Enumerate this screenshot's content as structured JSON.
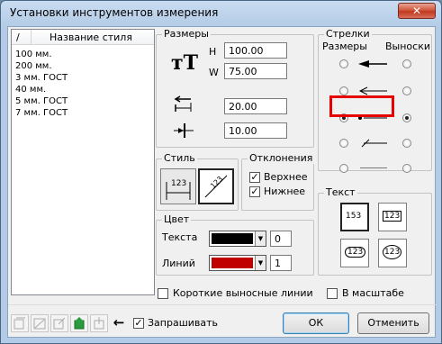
{
  "window": {
    "title": "Установки инструментов измерения",
    "close_glyph": "✕"
  },
  "list": {
    "sort_glyph": "/",
    "header": "Название стиля",
    "items": [
      "100 мм.",
      "200 мм.",
      "3 мм. ГОСТ",
      "40 мм.",
      "5 мм. ГОСТ",
      "7 мм. ГОСТ"
    ]
  },
  "sizes": {
    "label": "Размеры",
    "font_icon": "тТ",
    "h_label": "H",
    "w_label": "W",
    "h_value": "100.00",
    "w_value": "75.00",
    "offset_value": "20.00",
    "arrow_value": "10.00"
  },
  "arrows": {
    "label": "Стрелки",
    "col_sizes": "Размеры",
    "col_leaders": "Выноски",
    "selected_row": 2
  },
  "style": {
    "label": "Стиль",
    "btn1": "123",
    "btn2": "123"
  },
  "deviations": {
    "label": "Отклонения",
    "upper": "Верхнее",
    "lower": "Нижнее",
    "upper_checked": true,
    "lower_checked": true,
    "check_glyph": "✓"
  },
  "text": {
    "label": "Текст",
    "b1": "153",
    "b2": "123",
    "b3": "123",
    "b4": "123"
  },
  "color": {
    "label": "Цвет",
    "text_label": "Текста",
    "lines_label": "Линий",
    "text_color": "#000000",
    "lines_color": "#c00000",
    "text_index": "0",
    "lines_index": "1",
    "dropdown_glyph": "▼"
  },
  "options": {
    "short_leaders": "Короткие выносные линии",
    "to_scale": "В масштабе",
    "ask": "Запрашивать",
    "ask_checked": true
  },
  "buttons": {
    "ok": "ОК",
    "cancel": "Отменить"
  },
  "toolbar": {
    "arrow_glyph": "←"
  }
}
